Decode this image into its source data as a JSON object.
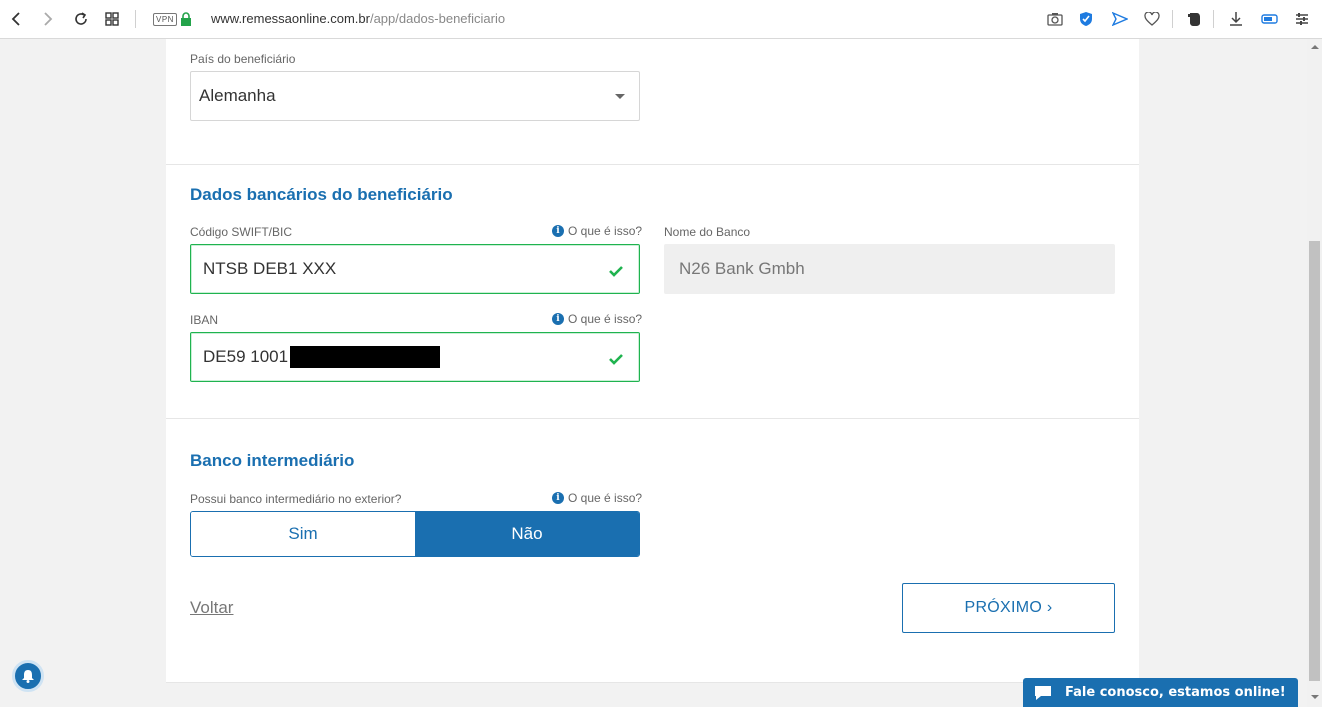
{
  "browser": {
    "vpn_label": "VPN",
    "url_domain": "www.remessaonline.com.br",
    "url_path": "/app/dados-beneficiario"
  },
  "country": {
    "label": "País do beneficiário",
    "value": "Alemanha"
  },
  "bank_section": {
    "title": "Dados bancários do beneficiário",
    "swift": {
      "label": "Código SWIFT/BIC",
      "help": "O que é isso?",
      "value": "NTSB DEB1 XXX"
    },
    "bank_name": {
      "label": "Nome do Banco",
      "value": "N26 Bank Gmbh"
    },
    "iban": {
      "label": "IBAN",
      "help": "O que é isso?",
      "value": "DE59 1001"
    }
  },
  "intermediary": {
    "title": "Banco intermediário",
    "question": "Possui banco intermediário no exterior?",
    "help": "O que é isso?",
    "option_yes": "Sim",
    "option_no": "Não",
    "selected": "Não"
  },
  "nav": {
    "back": "Voltar",
    "next": "PRÓXIMO ›"
  },
  "chat": {
    "label": "Fale conosco, estamos online!"
  },
  "colors": {
    "brand": "#1a6fb0",
    "valid": "#1fb34f"
  }
}
